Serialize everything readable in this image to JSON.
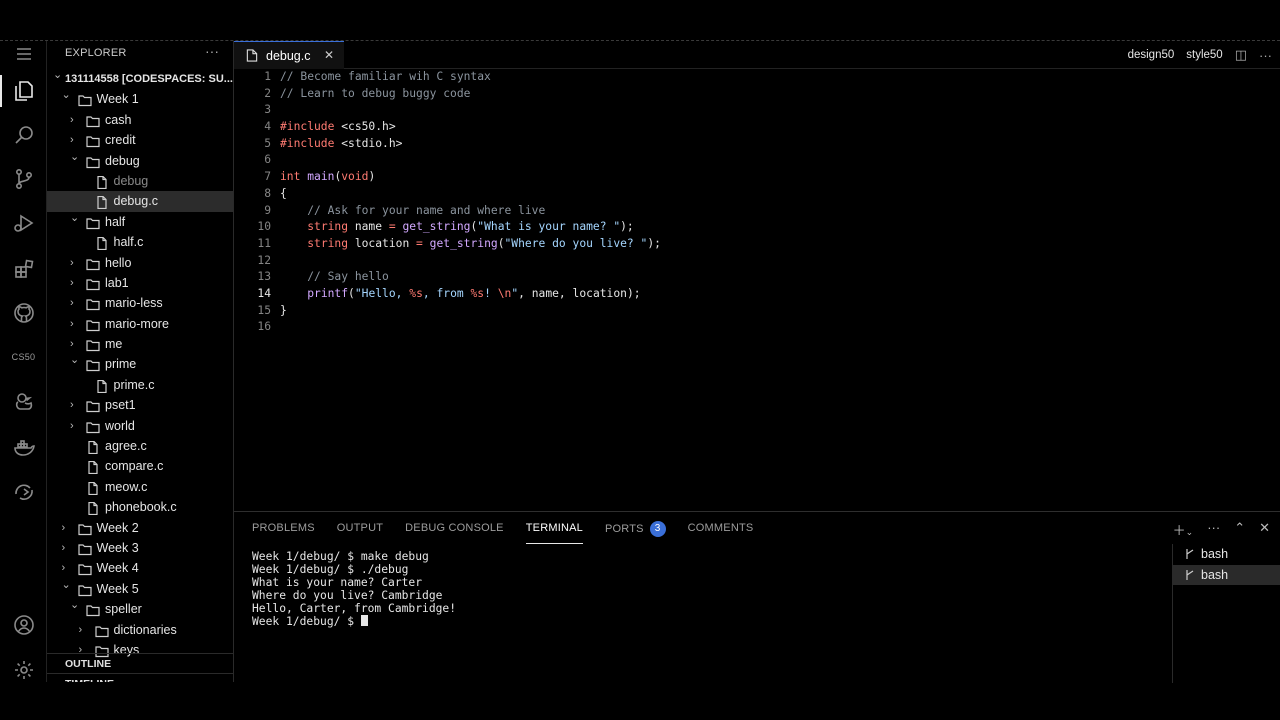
{
  "activity_bar": {
    "items": [
      {
        "icon": "menu-icon"
      },
      {
        "icon": "files-icon"
      },
      {
        "icon": "search-icon"
      },
      {
        "icon": "source-control-icon"
      },
      {
        "icon": "run-debug-icon"
      },
      {
        "icon": "extensions-icon"
      },
      {
        "icon": "github-icon"
      },
      {
        "icon": "cs50-icon",
        "label": "CS50"
      },
      {
        "icon": "duck-icon"
      },
      {
        "icon": "docker-icon"
      },
      {
        "icon": "remote-explorer-icon"
      },
      {
        "icon": "account-icon"
      },
      {
        "icon": "gear-icon"
      }
    ]
  },
  "sidebar": {
    "title": "EXPLORER",
    "more": "···",
    "tree": [
      {
        "label": "131114558 [CODESPACES: SU...",
        "depth": 0,
        "type": "root",
        "open": true
      },
      {
        "label": "Week 1",
        "depth": 1,
        "type": "folder",
        "open": true
      },
      {
        "label": "cash",
        "depth": 2,
        "type": "folder",
        "open": false
      },
      {
        "label": "credit",
        "depth": 2,
        "type": "folder",
        "open": false
      },
      {
        "label": "debug",
        "depth": 2,
        "type": "folder",
        "open": true
      },
      {
        "label": "debug",
        "depth": 3,
        "type": "file",
        "dim": true
      },
      {
        "label": "debug.c",
        "depth": 3,
        "type": "file",
        "selected": true
      },
      {
        "label": "half",
        "depth": 2,
        "type": "folder",
        "open": true
      },
      {
        "label": "half.c",
        "depth": 3,
        "type": "file"
      },
      {
        "label": "hello",
        "depth": 2,
        "type": "folder",
        "open": false
      },
      {
        "label": "lab1",
        "depth": 2,
        "type": "folder",
        "open": false
      },
      {
        "label": "mario-less",
        "depth": 2,
        "type": "folder",
        "open": false
      },
      {
        "label": "mario-more",
        "depth": 2,
        "type": "folder",
        "open": false
      },
      {
        "label": "me",
        "depth": 2,
        "type": "folder",
        "open": false
      },
      {
        "label": "prime",
        "depth": 2,
        "type": "folder",
        "open": true
      },
      {
        "label": "prime.c",
        "depth": 3,
        "type": "file"
      },
      {
        "label": "pset1",
        "depth": 2,
        "type": "folder",
        "open": false
      },
      {
        "label": "world",
        "depth": 2,
        "type": "folder",
        "open": false
      },
      {
        "label": "agree.c",
        "depth": 2,
        "type": "file"
      },
      {
        "label": "compare.c",
        "depth": 2,
        "type": "file"
      },
      {
        "label": "meow.c",
        "depth": 2,
        "type": "file"
      },
      {
        "label": "phonebook.c",
        "depth": 2,
        "type": "file"
      },
      {
        "label": "Week 2",
        "depth": 1,
        "type": "folder",
        "open": false
      },
      {
        "label": "Week 3",
        "depth": 1,
        "type": "folder",
        "open": false
      },
      {
        "label": "Week 4",
        "depth": 1,
        "type": "folder",
        "open": false
      },
      {
        "label": "Week 5",
        "depth": 1,
        "type": "folder",
        "open": true
      },
      {
        "label": "speller",
        "depth": 2,
        "type": "folder",
        "open": true
      },
      {
        "label": "dictionaries",
        "depth": 3,
        "type": "folder",
        "open": false
      },
      {
        "label": "keys",
        "depth": 3,
        "type": "folder",
        "open": false
      }
    ],
    "outline_label": "OUTLINE",
    "timeline_label": "TIMELINE"
  },
  "editor": {
    "tab_label": "debug.c",
    "tab_close": "✕",
    "actions": {
      "design50": "design50",
      "style50": "style50"
    },
    "current_line": 14,
    "lines": [
      {
        "n": "1",
        "tokens": [
          {
            "t": "// Become familiar wih C syntax",
            "c": "com"
          }
        ]
      },
      {
        "n": "2",
        "tokens": [
          {
            "t": "// Learn to debug buggy code",
            "c": "com"
          }
        ]
      },
      {
        "n": "3",
        "tokens": []
      },
      {
        "n": "4",
        "tokens": [
          {
            "t": "#include",
            "c": "pp"
          },
          {
            "t": " <cs50.h>",
            "c": ""
          }
        ]
      },
      {
        "n": "5",
        "tokens": [
          {
            "t": "#include",
            "c": "pp"
          },
          {
            "t": " <stdio.h>",
            "c": ""
          }
        ]
      },
      {
        "n": "6",
        "tokens": []
      },
      {
        "n": "7",
        "tokens": [
          {
            "t": "int",
            "c": "kw"
          },
          {
            "t": " ",
            "c": ""
          },
          {
            "t": "main",
            "c": "fn"
          },
          {
            "t": "(",
            "c": ""
          },
          {
            "t": "void",
            "c": "kw"
          },
          {
            "t": ")",
            "c": ""
          }
        ]
      },
      {
        "n": "8",
        "tokens": [
          {
            "t": "{",
            "c": ""
          }
        ]
      },
      {
        "n": "9",
        "tokens": [
          {
            "t": "    // Ask for your name and where live",
            "c": "com"
          }
        ]
      },
      {
        "n": "10",
        "tokens": [
          {
            "t": "    ",
            "c": ""
          },
          {
            "t": "string",
            "c": "kw"
          },
          {
            "t": " name ",
            "c": ""
          },
          {
            "t": "=",
            "c": "kw"
          },
          {
            "t": " ",
            "c": ""
          },
          {
            "t": "get_string",
            "c": "fn"
          },
          {
            "t": "(",
            "c": ""
          },
          {
            "t": "\"What is your name? \"",
            "c": "str"
          },
          {
            "t": ");",
            "c": ""
          }
        ]
      },
      {
        "n": "11",
        "tokens": [
          {
            "t": "    ",
            "c": ""
          },
          {
            "t": "string",
            "c": "kw"
          },
          {
            "t": " location ",
            "c": ""
          },
          {
            "t": "=",
            "c": "kw"
          },
          {
            "t": " ",
            "c": ""
          },
          {
            "t": "get_string",
            "c": "fn"
          },
          {
            "t": "(",
            "c": ""
          },
          {
            "t": "\"Where do you live? \"",
            "c": "str"
          },
          {
            "t": ");",
            "c": ""
          }
        ]
      },
      {
        "n": "12",
        "tokens": []
      },
      {
        "n": "13",
        "tokens": [
          {
            "t": "    // Say hello",
            "c": "com"
          }
        ]
      },
      {
        "n": "14",
        "tokens": [
          {
            "t": "    ",
            "c": ""
          },
          {
            "t": "printf",
            "c": "fn"
          },
          {
            "t": "(",
            "c": ""
          },
          {
            "t": "\"Hello, ",
            "c": "str"
          },
          {
            "t": "%s",
            "c": "fmt"
          },
          {
            "t": ", from ",
            "c": "str"
          },
          {
            "t": "%s",
            "c": "fmt"
          },
          {
            "t": "! ",
            "c": "str"
          },
          {
            "t": "\\n",
            "c": "fmt"
          },
          {
            "t": "\"",
            "c": "str"
          },
          {
            "t": ", name, location);",
            "c": ""
          }
        ]
      },
      {
        "n": "15",
        "tokens": [
          {
            "t": "}",
            "c": ""
          }
        ]
      },
      {
        "n": "16",
        "tokens": []
      }
    ]
  },
  "panel": {
    "tabs": [
      "PROBLEMS",
      "OUTPUT",
      "DEBUG CONSOLE",
      "TERMINAL",
      "PORTS",
      "COMMENTS"
    ],
    "active_tab": "TERMINAL",
    "ports_badge": "3",
    "terminal_lines": [
      "Week 1/debug/ $ make debug",
      "Week 1/debug/ $ ./debug",
      "What is your name? Carter",
      "Where do you live? Cambridge",
      "Hello, Carter, from Cambridge!",
      "Week 1/debug/ $ "
    ],
    "terminals": [
      {
        "label": "bash",
        "selected": false
      },
      {
        "label": "bash",
        "selected": true
      }
    ]
  }
}
